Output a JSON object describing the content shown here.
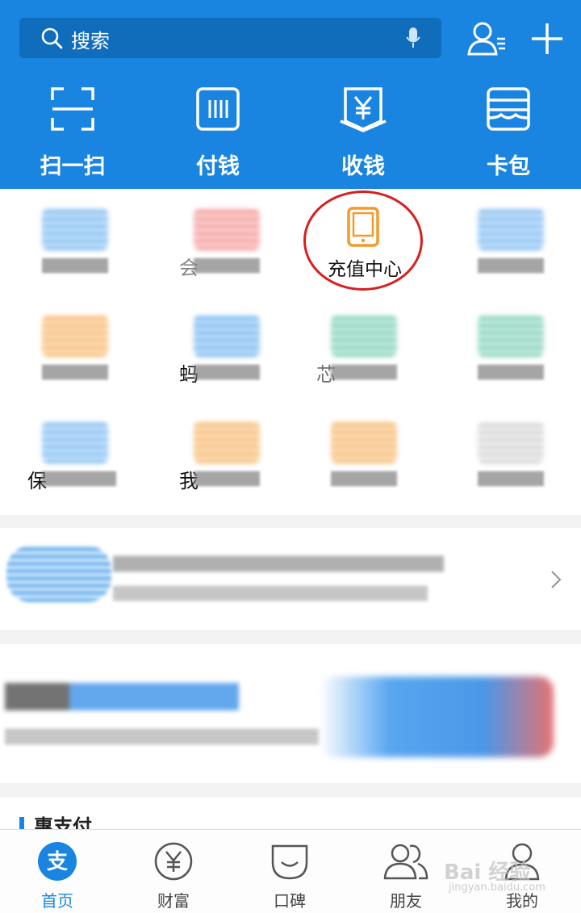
{
  "search": {
    "placeholder": "搜索"
  },
  "quick_actions": [
    {
      "label": "扫一扫",
      "icon": "scan-icon"
    },
    {
      "label": "付钱",
      "icon": "barcode-icon"
    },
    {
      "label": "收钱",
      "icon": "yuan-receipt-icon"
    },
    {
      "label": "卡包",
      "icon": "card-wallet-icon"
    }
  ],
  "grid": {
    "highlight_label": "充值中心",
    "partials": [
      "会",
      "蚂",
      "芯",
      "保",
      "我"
    ]
  },
  "section": {
    "title": "惠支付"
  },
  "tabs": [
    {
      "label": "首页",
      "icon": "alipay-icon"
    },
    {
      "label": "财富",
      "icon": "wealth-yuan-icon"
    },
    {
      "label": "口碑",
      "icon": "koubei-icon"
    },
    {
      "label": "朋友",
      "icon": "friends-icon"
    },
    {
      "label": "我的",
      "icon": "profile-icon"
    }
  ],
  "watermark": {
    "brand": "Bai 经验",
    "url": "jingyan.baidu.com"
  },
  "colors": {
    "brand_blue": "#1a85e0",
    "highlight_ring": "#d81e1e",
    "recharge_orange": "#f39a2c"
  }
}
